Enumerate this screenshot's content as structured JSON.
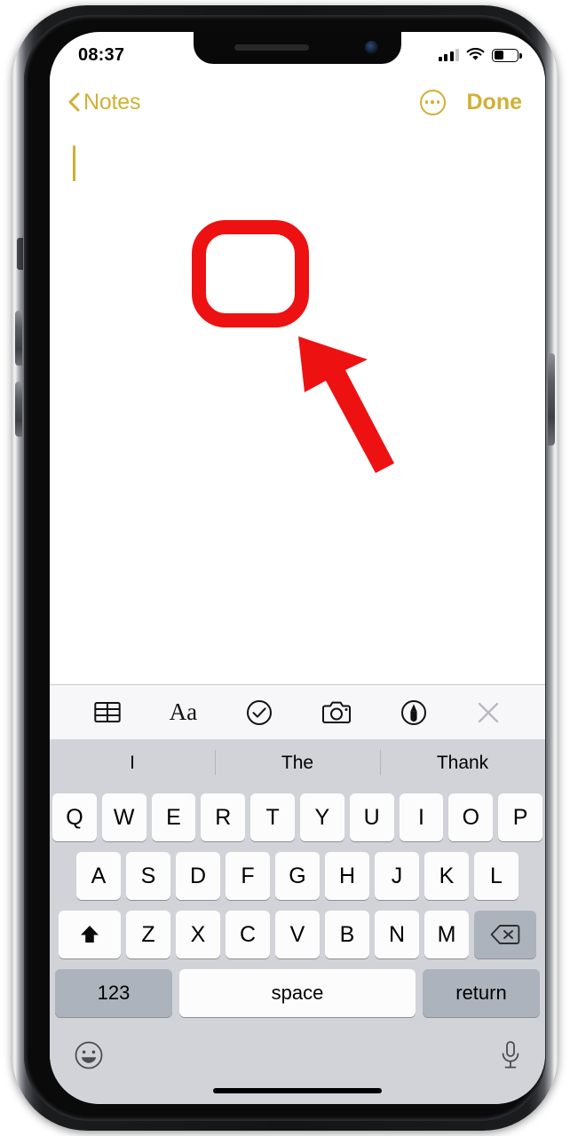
{
  "theme": {
    "accent_color": "#d1b034",
    "annotation_color": "#ee1111",
    "keyboard_bg": "#d1d3d9"
  },
  "status_bar": {
    "time": "08:37",
    "cellular_icon": "signal-bars-icon",
    "cellular_bars_filled": 3,
    "cellular_bars_total": 4,
    "wifi_icon": "wifi-icon",
    "battery_icon": "battery-icon",
    "battery_percent": 40
  },
  "nav_bar": {
    "back_icon": "chevron-left-icon",
    "back_label": "Notes",
    "more_icon": "more-circle-icon",
    "done_label": "Done"
  },
  "note": {
    "body_text": "",
    "cursor_visible": true
  },
  "annotations": [
    {
      "type": "rounded-rect-highlight",
      "name": "red-highlight-box",
      "color": "#ee1111"
    },
    {
      "type": "arrow",
      "name": "red-pointer-arrow",
      "color": "#ee1111",
      "points_to": "red-highlight-box"
    }
  ],
  "format_toolbar": {
    "buttons": [
      {
        "name": "table-button",
        "icon": "table-icon",
        "label": ""
      },
      {
        "name": "format-button",
        "icon": "aa-icon",
        "label": "Aa"
      },
      {
        "name": "checklist-button",
        "icon": "checkmark-circle-icon",
        "label": ""
      },
      {
        "name": "camera-button",
        "icon": "camera-icon",
        "label": ""
      },
      {
        "name": "markup-button",
        "icon": "markup-pen-icon",
        "label": ""
      },
      {
        "name": "close-keyboard-button",
        "icon": "close-x-icon",
        "label": ""
      }
    ]
  },
  "predictive_bar": {
    "suggestions": [
      "I",
      "The",
      "Thank"
    ]
  },
  "keyboard": {
    "row1": [
      "Q",
      "W",
      "E",
      "R",
      "T",
      "Y",
      "U",
      "I",
      "O",
      "P"
    ],
    "row2": [
      "A",
      "S",
      "D",
      "F",
      "G",
      "H",
      "J",
      "K",
      "L"
    ],
    "row3_letters": [
      "Z",
      "X",
      "C",
      "V",
      "B",
      "N",
      "M"
    ],
    "shift_icon": "shift-up-arrow-icon",
    "backspace_icon": "backspace-delete-icon",
    "numbers_label": "123",
    "space_label": "space",
    "return_label": "return",
    "emoji_icon": "emoji-smiley-icon",
    "dictation_icon": "microphone-icon"
  },
  "device": {
    "speaker_icon": "earpiece-speaker",
    "camera_icon": "front-camera",
    "buttons": [
      "mute-switch",
      "volume-up",
      "volume-down",
      "power"
    ]
  }
}
